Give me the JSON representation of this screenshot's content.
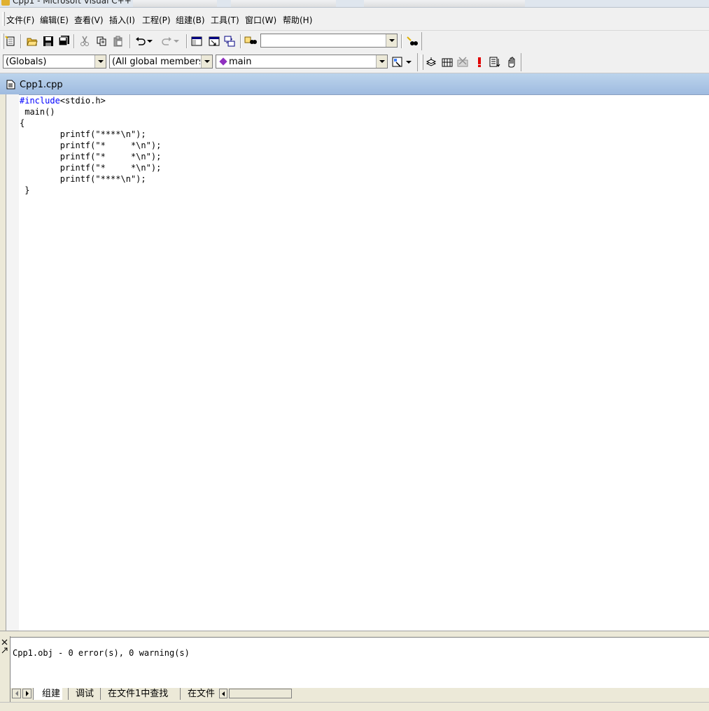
{
  "window": {
    "title": "Cpp1 - Microsoft Visual C++"
  },
  "menu": [
    "文件(F)",
    "编辑(E)",
    "查看(V)",
    "插入(I)",
    "工程(P)",
    "组建(B)",
    "工具(T)",
    "窗口(W)",
    "帮助(H)"
  ],
  "toolbar": {
    "find_combo_value": "",
    "scope_combo": "(Globals)",
    "members_combo": "(All global members",
    "function_combo": "main"
  },
  "document": {
    "tab_title": "Cpp1.cpp",
    "code": {
      "line1_keyword": "#include",
      "line1_rest": "<stdio.h>",
      "line2": " main()",
      "line3": "{",
      "line4": "        printf(\"****\\n\");",
      "line5": "        printf(\"*     *\\n\");",
      "line6": "        printf(\"*     *\\n\");",
      "line7": "        printf(\"*     *\\n\");",
      "line8": "        printf(\"****\\n\");",
      "line9": " }"
    }
  },
  "output": {
    "message": "Cpp1.obj - 0 error(s), 0 warning(s)",
    "tabs": [
      "组建",
      "调试",
      "在文件1中查找",
      "在文件"
    ]
  },
  "colors": {
    "keyword": "#0000ff",
    "doc_tab": "#b2cbe8",
    "chrome": "#ece9d8"
  }
}
